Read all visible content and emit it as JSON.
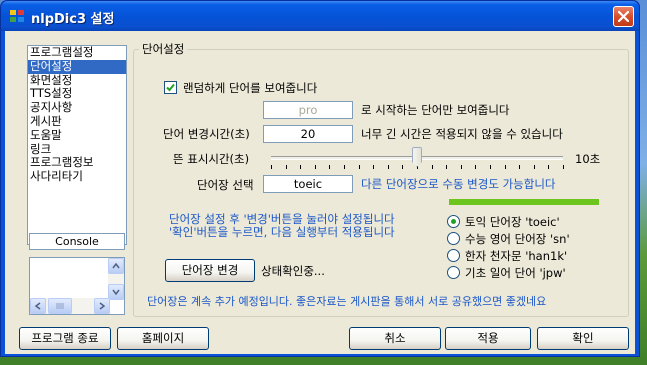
{
  "window": {
    "title": "nlpDic3 설정",
    "app_icon": "dictionary-app-icon",
    "close_icon": "close-x-icon"
  },
  "sidebar": {
    "items": [
      {
        "label": "프로그램설정",
        "selected": false
      },
      {
        "label": "단어설정",
        "selected": true
      },
      {
        "label": "화면설정",
        "selected": false
      },
      {
        "label": "TTS설정",
        "selected": false
      },
      {
        "label": "공지사항",
        "selected": false
      },
      {
        "label": "게시판",
        "selected": false
      },
      {
        "label": "도움말",
        "selected": false
      },
      {
        "label": "링크",
        "selected": false
      },
      {
        "label": "프로그램정보",
        "selected": false
      },
      {
        "label": "사다리타기",
        "selected": false
      }
    ],
    "console_label": "Console"
  },
  "settings": {
    "group_title": "단어설정",
    "random_checkbox_label": "랜덤하게 단어를 보여줍니다",
    "random_checked": true,
    "prefix_value": "pro",
    "prefix_suffix_label": "로 시작하는 단어만 보여줍니다",
    "interval_label": "단어 변경시간(초)",
    "interval_value": "20",
    "interval_warning": "너무 긴 시간은 적용되지 않을 수 있습니다",
    "display_time_label": "뜬 표시시간(초)",
    "display_time_max_label": "10초",
    "display_time_level": 0.5,
    "wordbook_label": "단어장 선택",
    "wordbook_value": "toeic",
    "wordbook_hint": "다른 단어장으로 수동 변경도 가능합니다",
    "instruction_line1": "단어장 설정 후 '변경'버튼을 눌러야 설정됩니다",
    "instruction_line2": "'확인'버튼을 누르면, 다음 실행부터 적용됩니다",
    "change_wordbook_button": "단어장 변경",
    "status_text": "상태확인중...",
    "wordbook_options": [
      {
        "label": "토익 단어장 'toeic'",
        "selected": true
      },
      {
        "label": "수능 영어 단어장 'sn'",
        "selected": false
      },
      {
        "label": "한자 천자문 'han1k'",
        "selected": false
      },
      {
        "label": "기초 일어 단어 'jpw'",
        "selected": false
      }
    ],
    "footer_note": "단어장은 계속 추가 예정입니다. 좋은자료는 게시판을 통해서 서로 공유했으면 좋겠네요",
    "accent_green": "#6cc61e",
    "hint_blue": "#1a57c8"
  },
  "buttons": {
    "exit": "프로그램 종료",
    "homepage": "홈페이지",
    "cancel": "취소",
    "apply": "적용",
    "ok": "확인"
  }
}
